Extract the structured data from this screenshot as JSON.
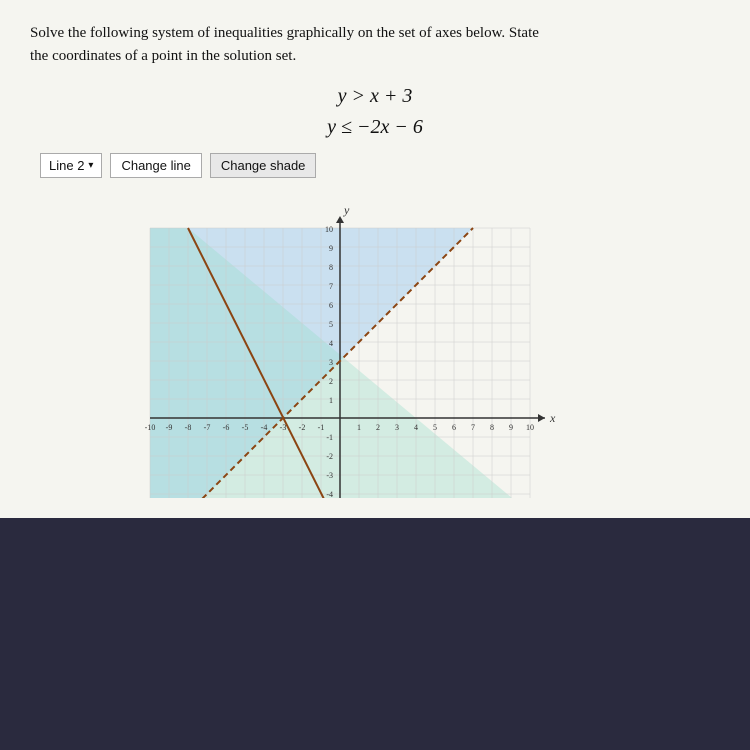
{
  "problem": {
    "text_line1": "Solve the following system of inequalities graphically on the set of axes below. State",
    "text_line2": "the coordinates of a point in the solution set."
  },
  "equations": {
    "eq1": "y > x + 3",
    "eq2": "y ≤ −2x − 6"
  },
  "controls": {
    "dropdown_label": "Line 2",
    "change_line_label": "Change line",
    "change_shade_label": "Change shade"
  },
  "graph": {
    "x_min": -10,
    "x_max": 10,
    "y_min": -5,
    "y_max": 10
  }
}
